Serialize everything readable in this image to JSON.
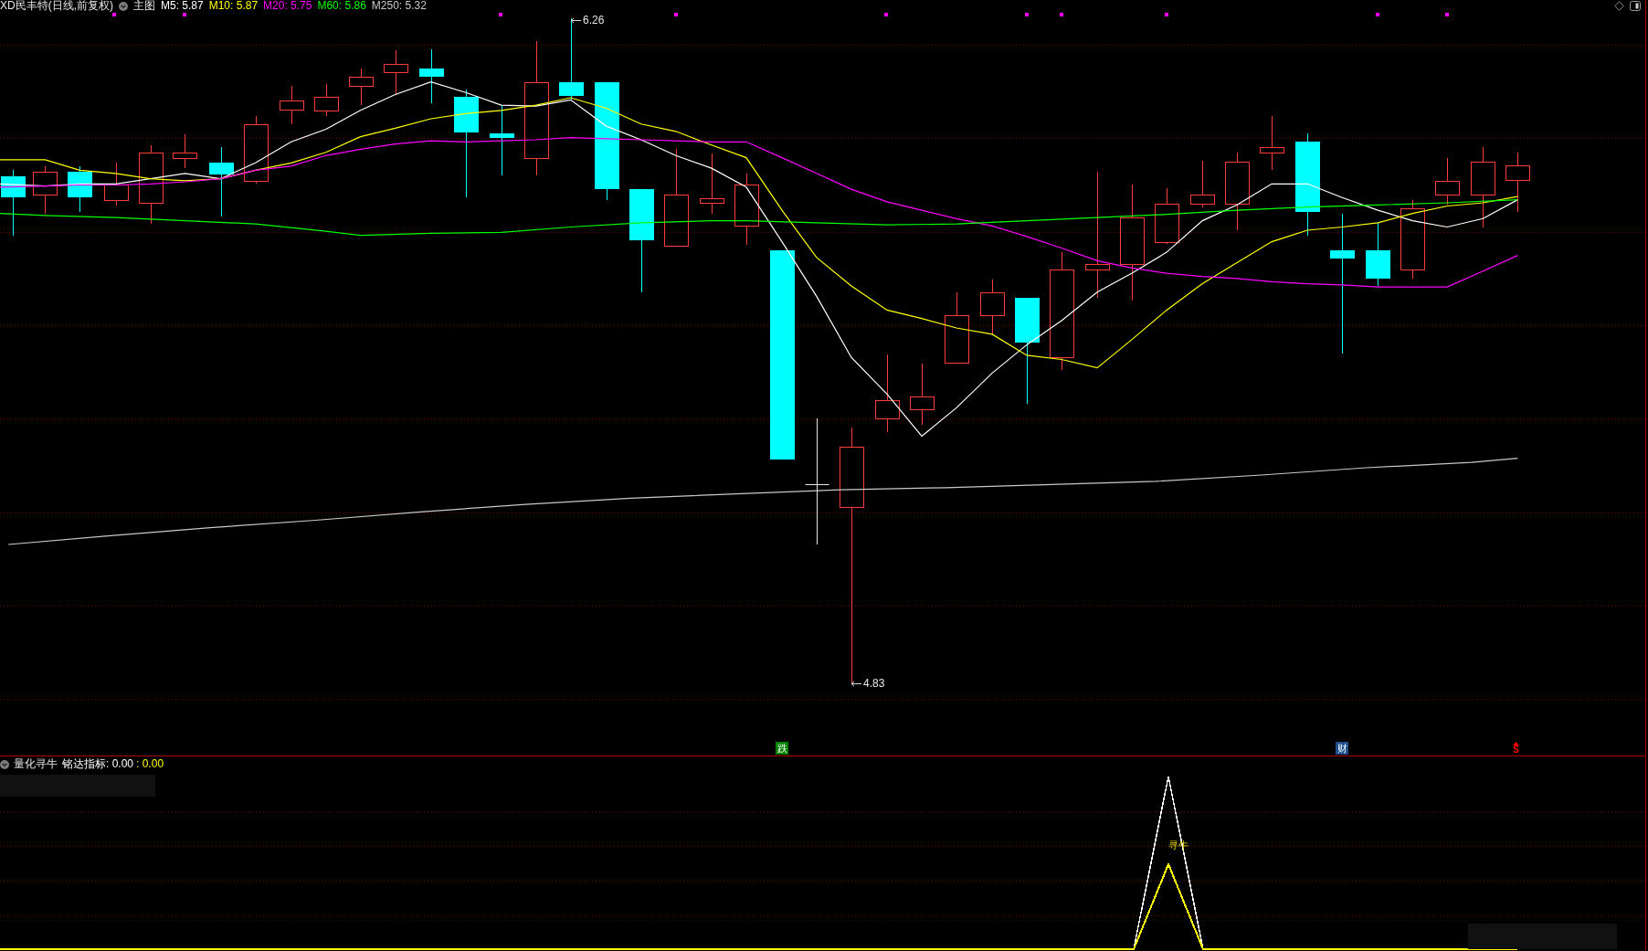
{
  "main_chart": {
    "title": "XD民丰特(日线,前复权)",
    "pane_label": "主图",
    "ma_readings": [
      {
        "label": "M5: 5.87",
        "color": "#ffffff"
      },
      {
        "label": "M10: 5.87",
        "color": "#ffff00"
      },
      {
        "label": "M20: 5.75",
        "color": "#ff00ff"
      },
      {
        "label": "M60: 5.86",
        "color": "#00ff00"
      },
      {
        "label": "M250: 5.32",
        "color": "#c8c8c8"
      }
    ],
    "high_label": "6.26",
    "low_label": "4.83",
    "signals": [
      {
        "kind": "box",
        "text": "跌",
        "color": "#008000"
      },
      {
        "kind": "box",
        "text": "财",
        "color": "#1c4f8c"
      },
      {
        "kind": "arrow",
        "text": "S",
        "color": "#ff0000"
      }
    ]
  },
  "indicator": {
    "name": "量化寻牛",
    "readings": [
      {
        "label": "铭达指标: 0.00",
        "color": "#ffffff"
      },
      {
        "label": ": 0.00",
        "color": "#ffff00"
      }
    ],
    "signal_label": "寻牛"
  }
}
